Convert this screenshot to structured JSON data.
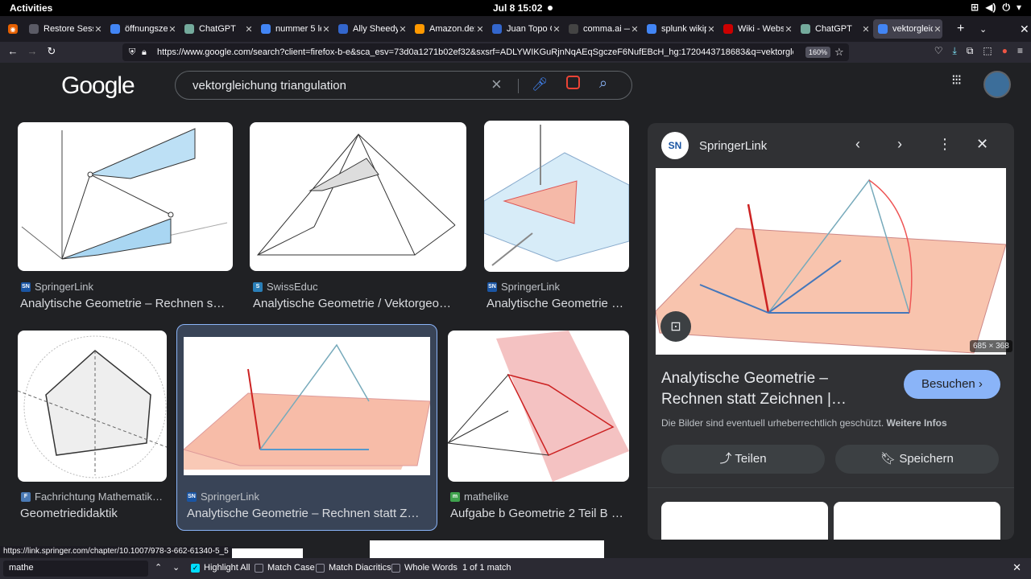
{
  "system": {
    "activities": "Activities",
    "clock": "Jul 8  15:02"
  },
  "tabs": [
    {
      "label": "Restore Sessi",
      "color": "#5b5b66"
    },
    {
      "label": "öffnungszeit",
      "color": "#4285f4"
    },
    {
      "label": "ChatGPT",
      "color": "#74aa9c"
    },
    {
      "label": "nummer 5 le",
      "color": "#4285f4"
    },
    {
      "label": "Ally Sheedy",
      "color": "#3366cc"
    },
    {
      "label": "Amazon.de: ",
      "color": "#ff9900"
    },
    {
      "label": "Juan Topo Gi",
      "color": "#3366cc"
    },
    {
      "label": "comma.ai —",
      "color": "#444"
    },
    {
      "label": "splunk wikip",
      "color": "#4285f4"
    },
    {
      "label": "Wiki - Websi",
      "color": "#cc0000"
    },
    {
      "label": "ChatGPT",
      "color": "#74aa9c"
    },
    {
      "label": "vektorgleichu",
      "color": "#4285f4"
    }
  ],
  "browser": {
    "url": "https://www.google.com/search?client=firefox-b-e&sca_esv=73d0a1271b02ef32&sxsrf=ADLYWIKGuRjnNqAEqSgczeF6NufEBcH_hg:1720443718683&q=vektorgleichung+triangulation",
    "zoom": "160%"
  },
  "google": {
    "logo": "Google",
    "query": "vektorgleichung triangulation"
  },
  "results": [
    {
      "source": "SpringerLink",
      "title": "Analytische Geometrie – Rechnen s…",
      "fav": "SN",
      "favColor": "#1a55a3"
    },
    {
      "source": "SwissEduc",
      "title": "Analytische Geometrie / Vektorgeo…",
      "fav": "S",
      "favColor": "#2a7fb8"
    },
    {
      "source": "SpringerLink",
      "title": "Analytische Geometrie …",
      "fav": "SN",
      "favColor": "#1a55a3"
    },
    {
      "source": "Fachrichtung Mathematik…",
      "title": "Geometriedidaktik",
      "fav": "F",
      "favColor": "#4a7ab5"
    },
    {
      "source": "SpringerLink",
      "title": "Analytische Geometrie – Rechnen statt Z…",
      "fav": "SN",
      "favColor": "#1a55a3"
    },
    {
      "source": "mathelike",
      "title": "Aufgabe b Geometrie 2 Teil B …",
      "fav": "m",
      "favColor": "#3fa34d"
    }
  ],
  "panel": {
    "source": "SpringerLink",
    "logo": "SN",
    "dims": "685 × 368",
    "title": "Analytische Geometrie – Rechnen statt Zeichnen |…",
    "visit": "Besuchen",
    "note": "Die Bilder sind eventuell urheberrechtlich geschützt.",
    "note_link": "Weitere Infos",
    "share": "Teilen",
    "save": "Speichern"
  },
  "status_url": "https://link.springer.com/chapter/10.1007/978-3-662-61340-5_5",
  "findbar": {
    "value": "mathe",
    "highlight_all": "Highlight All",
    "match_case": "Match Case",
    "match_diacritics": "Match Diacritics",
    "whole_words": "Whole Words",
    "count": "1 of 1 match"
  }
}
